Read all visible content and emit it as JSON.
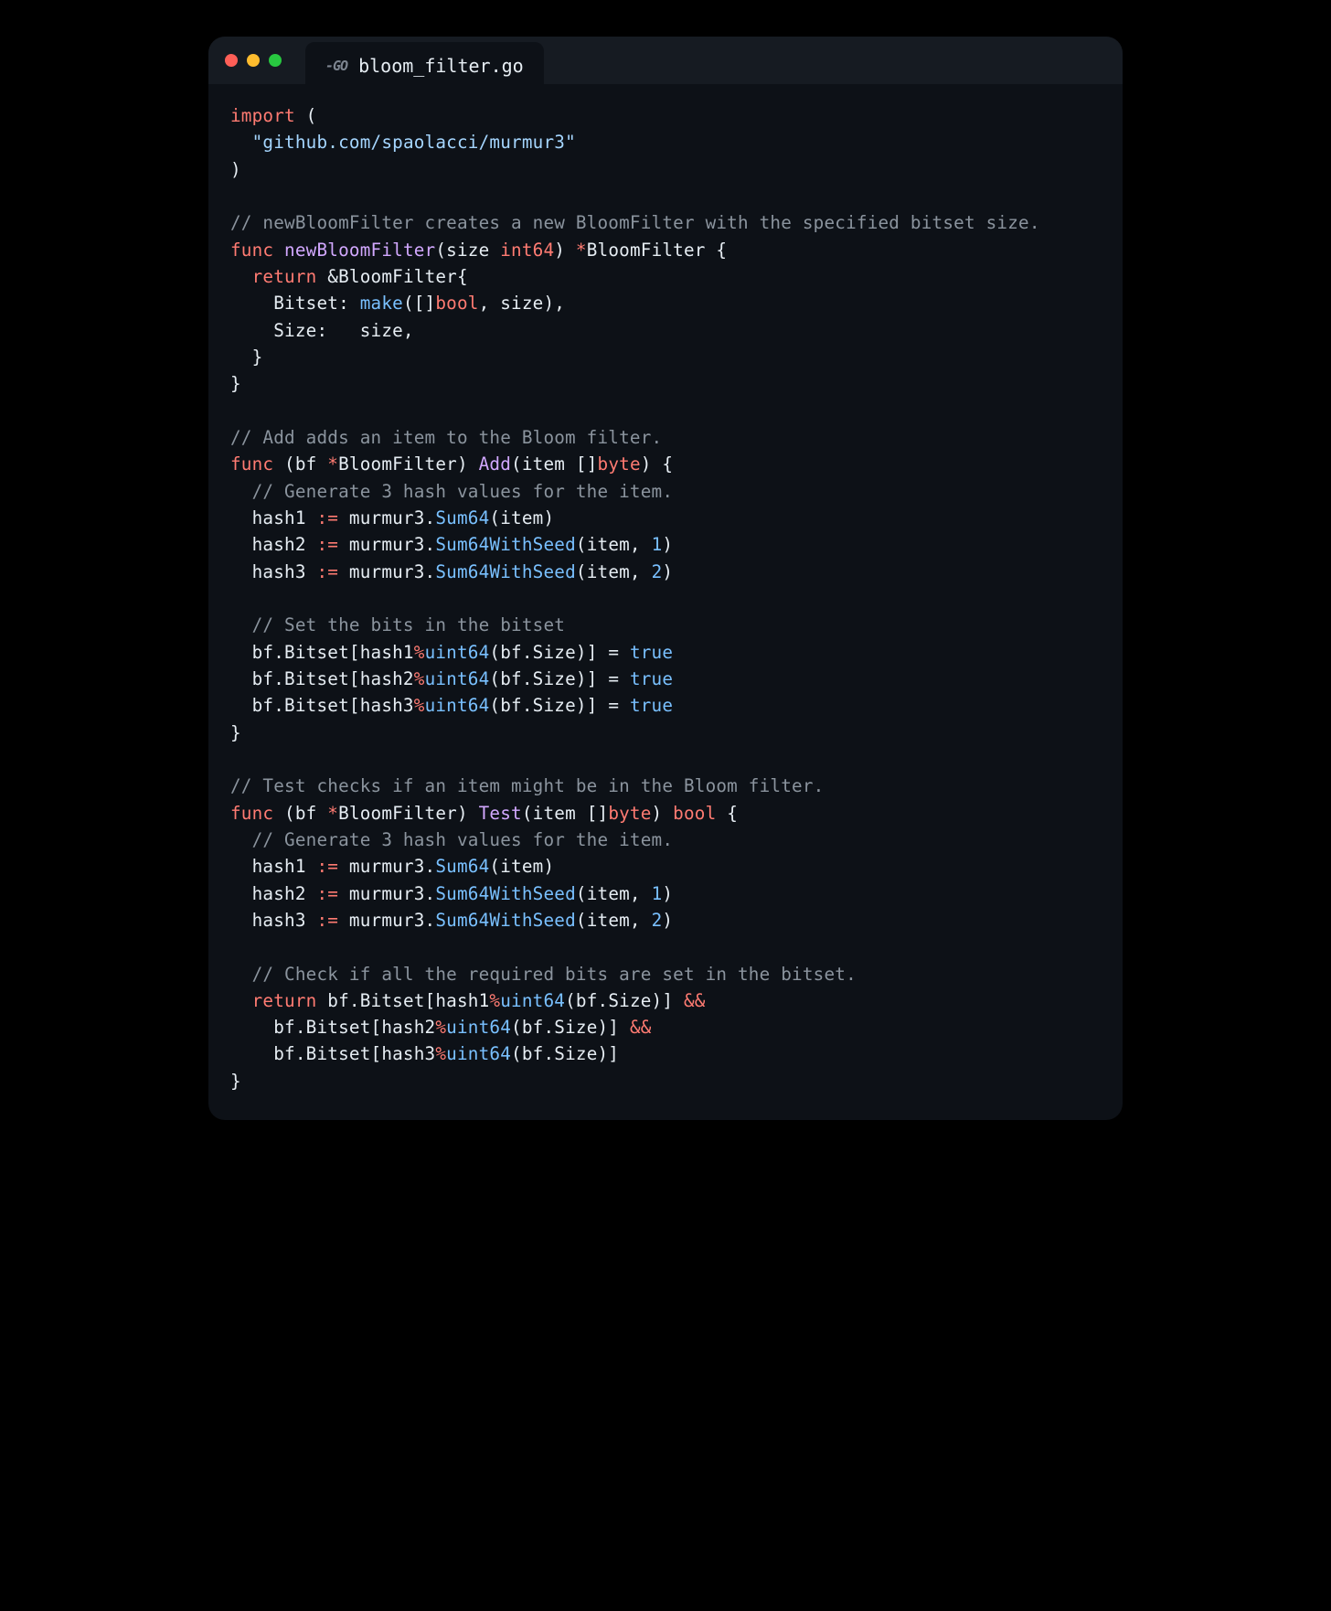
{
  "window": {
    "traffic": [
      "close",
      "minimize",
      "zoom"
    ],
    "tab_badge": "GO",
    "tab_title": "bloom_filter.go"
  },
  "code": {
    "l1a": "import",
    "l1b": " (",
    "l2a": "  ",
    "l2b": "\"github.com/spaolacci/murmur3\"",
    "l3": ")",
    "l5": "// newBloomFilter creates a new BloomFilter with the specified bitset size.",
    "l6a": "func",
    "l6b": " ",
    "l6c": "newBloomFilter",
    "l6d": "(size ",
    "l6e": "int64",
    "l6f": ") ",
    "l6g": "*",
    "l6h": "BloomFilter {",
    "l7a": "  ",
    "l7b": "return",
    "l7c": " &BloomFilter{",
    "l8a": "    Bitset: ",
    "l8b": "make",
    "l8c": "([]",
    "l8d": "bool",
    "l8e": ", size),",
    "l9": "    Size:   size,",
    "l10": "  }",
    "l11": "}",
    "l13": "// Add adds an item to the Bloom filter.",
    "l14a": "func",
    "l14b": " (bf ",
    "l14c": "*",
    "l14d": "BloomFilter) ",
    "l14e": "Add",
    "l14f": "(item []",
    "l14g": "byte",
    "l14h": ") {",
    "l15": "  // Generate 3 hash values for the item.",
    "l16a": "  hash1 ",
    "l16b": ":=",
    "l16c": " murmur3.",
    "l16d": "Sum64",
    "l16e": "(item)",
    "l17a": "  hash2 ",
    "l17b": ":=",
    "l17c": " murmur3.",
    "l17d": "Sum64WithSeed",
    "l17e": "(item, ",
    "l17f": "1",
    "l17g": ")",
    "l18a": "  hash3 ",
    "l18b": ":=",
    "l18c": " murmur3.",
    "l18d": "Sum64WithSeed",
    "l18e": "(item, ",
    "l18f": "2",
    "l18g": ")",
    "l20": "  // Set the bits in the bitset",
    "l21a": "  bf.Bitset[hash1",
    "l21b": "%",
    "l21c": "uint64",
    "l21d": "(bf.Size)] = ",
    "l21e": "true",
    "l22a": "  bf.Bitset[hash2",
    "l22b": "%",
    "l22c": "uint64",
    "l22d": "(bf.Size)] = ",
    "l22e": "true",
    "l23a": "  bf.Bitset[hash3",
    "l23b": "%",
    "l23c": "uint64",
    "l23d": "(bf.Size)] = ",
    "l23e": "true",
    "l24": "}",
    "l26": "// Test checks if an item might be in the Bloom filter.",
    "l27a": "func",
    "l27b": " (bf ",
    "l27c": "*",
    "l27d": "BloomFilter) ",
    "l27e": "Test",
    "l27f": "(item []",
    "l27g": "byte",
    "l27h": ") ",
    "l27i": "bool",
    "l27j": " {",
    "l28": "  // Generate 3 hash values for the item.",
    "l29a": "  hash1 ",
    "l29b": ":=",
    "l29c": " murmur3.",
    "l29d": "Sum64",
    "l29e": "(item)",
    "l30a": "  hash2 ",
    "l30b": ":=",
    "l30c": " murmur3.",
    "l30d": "Sum64WithSeed",
    "l30e": "(item, ",
    "l30f": "1",
    "l30g": ")",
    "l31a": "  hash3 ",
    "l31b": ":=",
    "l31c": " murmur3.",
    "l31d": "Sum64WithSeed",
    "l31e": "(item, ",
    "l31f": "2",
    "l31g": ")",
    "l33": "  // Check if all the required bits are set in the bitset.",
    "l34a": "  ",
    "l34b": "return",
    "l34c": " bf.Bitset[hash1",
    "l34d": "%",
    "l34e": "uint64",
    "l34f": "(bf.Size)] ",
    "l34g": "&&",
    "l35a": "    bf.Bitset[hash2",
    "l35b": "%",
    "l35c": "uint64",
    "l35d": "(bf.Size)] ",
    "l35e": "&&",
    "l36a": "    bf.Bitset[hash3",
    "l36b": "%",
    "l36c": "uint64",
    "l36d": "(bf.Size)]",
    "l37": "}"
  }
}
